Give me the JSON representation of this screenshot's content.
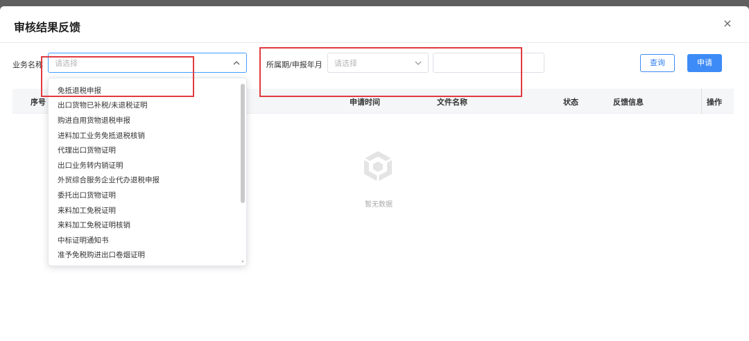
{
  "dialog": {
    "title": "审核结果反馈",
    "close_icon": "×"
  },
  "filters": {
    "business_label": "业务名称",
    "business_placeholder": "请选择",
    "period_label": "所属期/申报年月",
    "period_placeholder": "请选择",
    "period_input_value": "",
    "query_label": "查询",
    "apply_label": "申请"
  },
  "table": {
    "columns": [
      "序号",
      "申请时间",
      "文件名称",
      "状态",
      "反馈信息",
      "操作"
    ],
    "empty_text": "暂无数据"
  },
  "dropdown": {
    "options": [
      "免抵退税申报",
      "出口货物已补税/未退税证明",
      "购进自用货物退税申报",
      "进料加工业务免抵退税核销",
      "代理出口货物证明",
      "出口业务转内销证明",
      "外贸综合服务企业代办退税申报",
      "委托出口货物证明",
      "来料加工免税证明",
      "来料加工免税证明核销",
      "中标证明通知书",
      "准予免税购进出口卷烟证明"
    ]
  },
  "colors": {
    "primary": "#3d8bf6",
    "annotation_red": "#e0393e",
    "overlay": "#5f5f5f"
  },
  "icons": {
    "close": "close-icon",
    "arrow_up": "chevron-up-icon",
    "arrow_down": "chevron-down-icon",
    "empty": "empty-box-icon"
  }
}
